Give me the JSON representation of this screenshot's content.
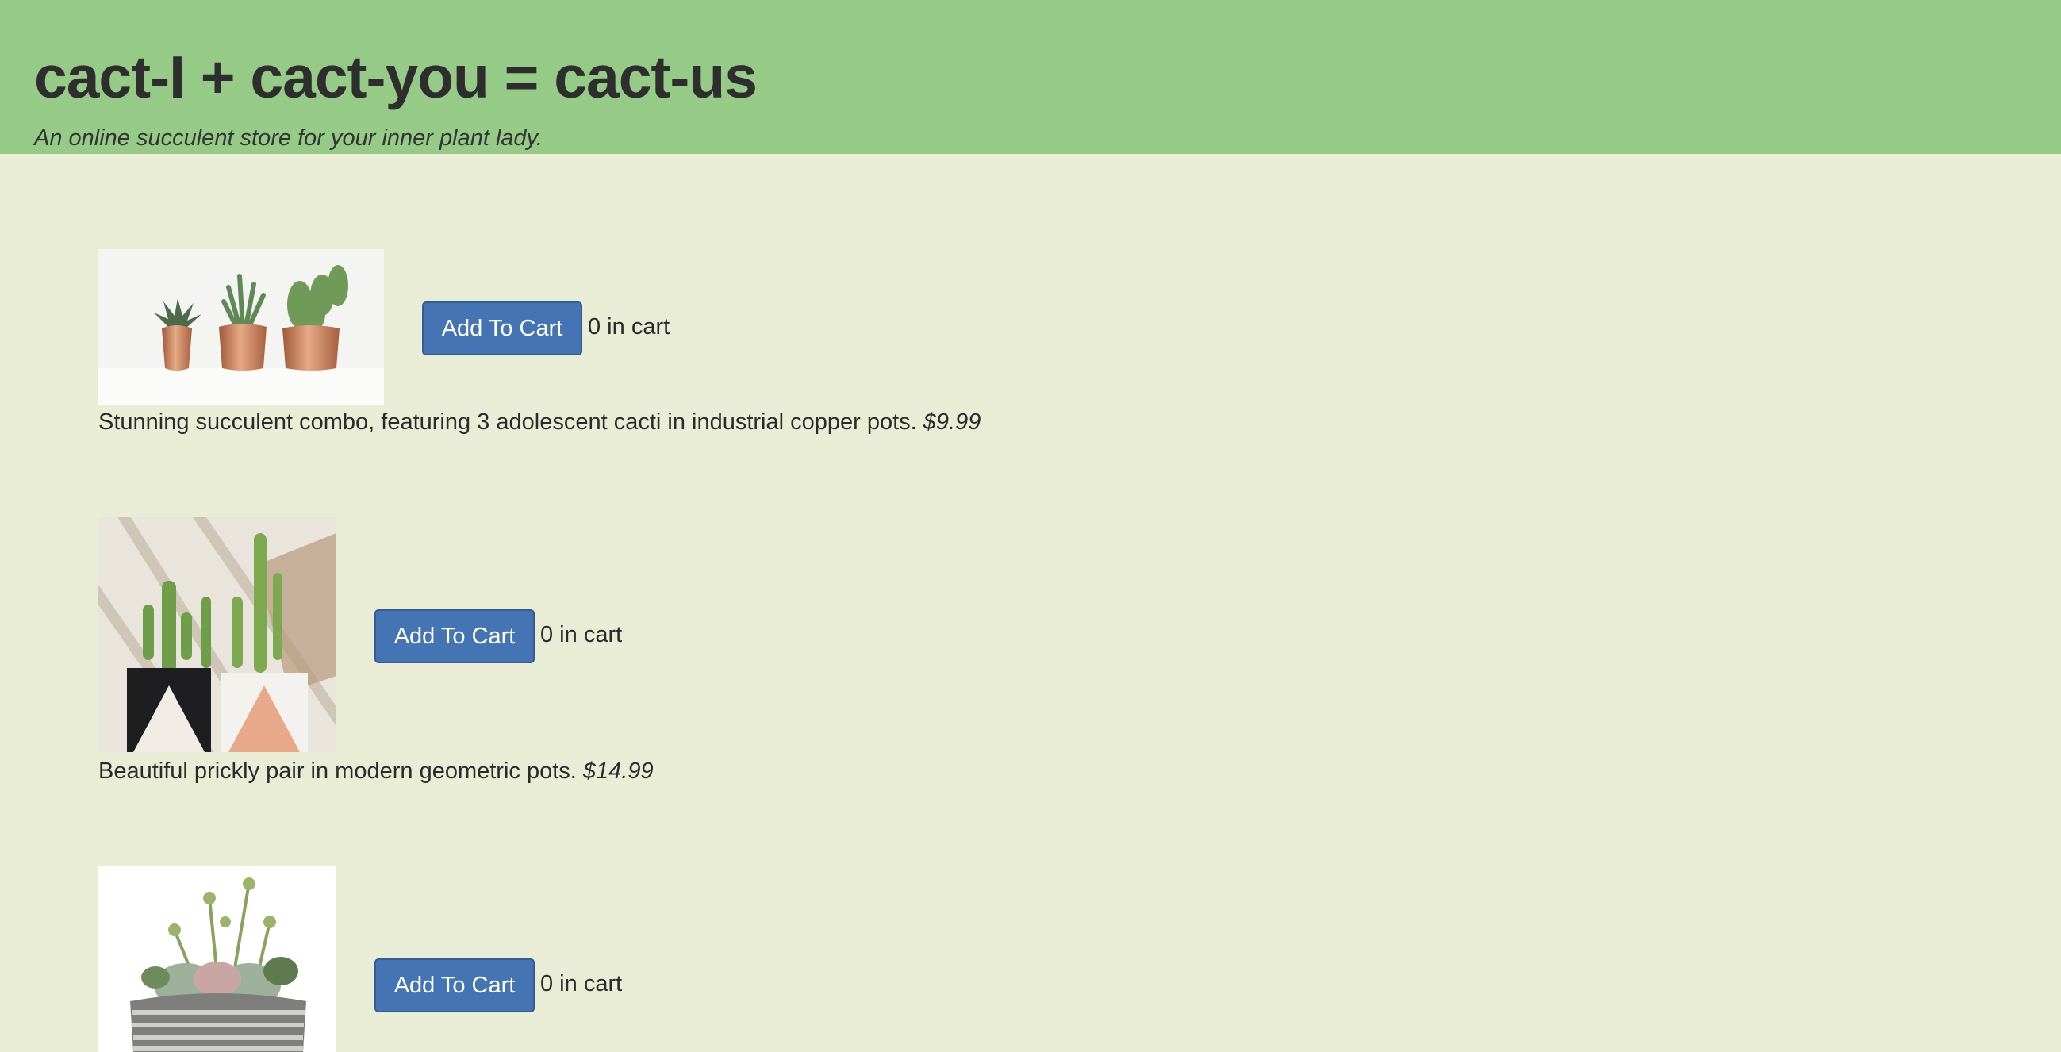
{
  "header": {
    "title": "cact-I + cact-you = cact-us",
    "tagline": "An online succulent store for your inner plant lady."
  },
  "products": [
    {
      "image": "three-cacti-copper-pots-photo",
      "button_label": "Add To Cart",
      "cart_count": "0 in cart",
      "description": "Stunning succulent combo, featuring 3 adolescent cacti in industrial copper pots.",
      "price": "$9.99"
    },
    {
      "image": "cactus-pair-geometric-pots-photo",
      "button_label": "Add To Cart",
      "cart_count": "0 in cart",
      "description": "Beautiful prickly pair in modern geometric pots.",
      "price": "$14.99"
    },
    {
      "image": "succulent-bowl-arrangement-photo",
      "button_label": "Add To Cart",
      "cart_count": "0 in cart"
    }
  ],
  "colors": {
    "header_bg": "#95cb87",
    "page_bg": "#eaedd6",
    "button_bg": "#4474b3"
  }
}
